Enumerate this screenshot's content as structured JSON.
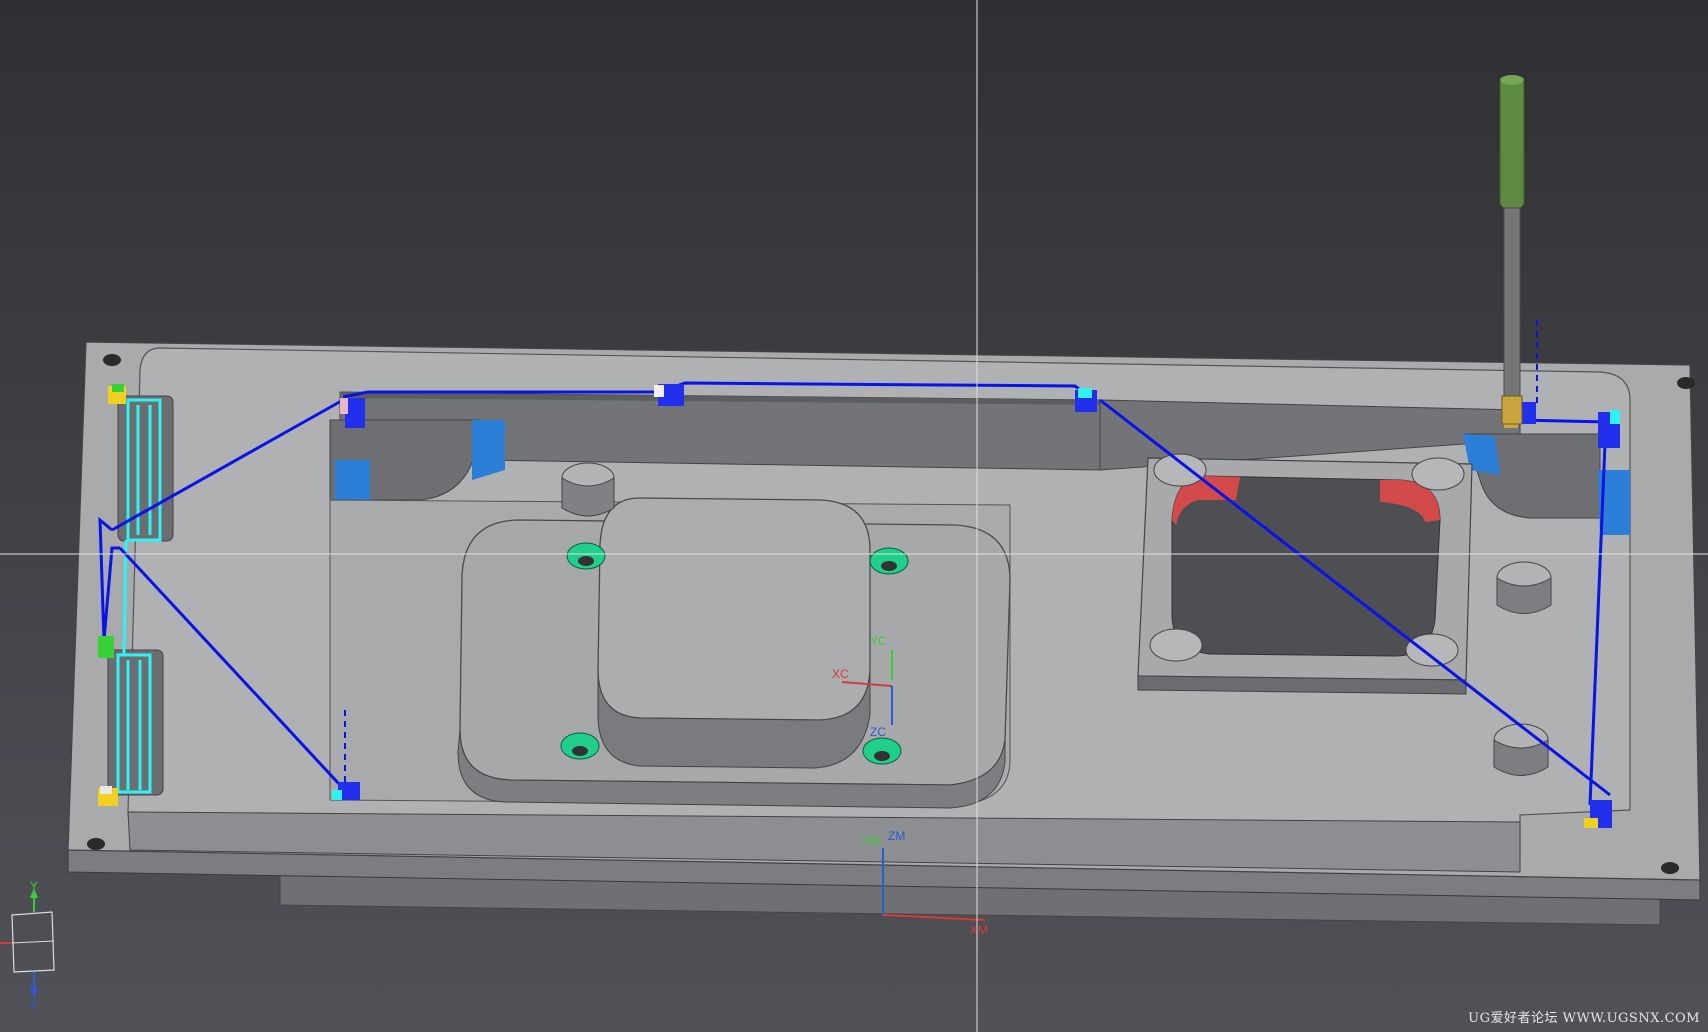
{
  "viewport": {
    "work_coords": {
      "x_label": "XC",
      "y_label": "YC",
      "z_label": "ZC"
    },
    "model_coords": {
      "y_label": "YM",
      "z_label": "ZM",
      "x_label": "XM"
    },
    "triad": {
      "y_label": "Y",
      "z_label": "Z"
    }
  },
  "colors": {
    "background_top": "#2e3033",
    "background_bottom": "#505257",
    "part_face": "#a9aaac",
    "part_side": "#7c7d80",
    "toolpath": "#0a14e6",
    "tool_holder": "#5e8a42",
    "tool_shank": "#757575",
    "wall_blue": "#2b7fd6",
    "wall_red": "#d24a4a",
    "hole_green": "#1fcf8a",
    "cyan_path": "#2ff2f2"
  },
  "watermark": "UG爱好者论坛 WWW.UGSNX.COM"
}
